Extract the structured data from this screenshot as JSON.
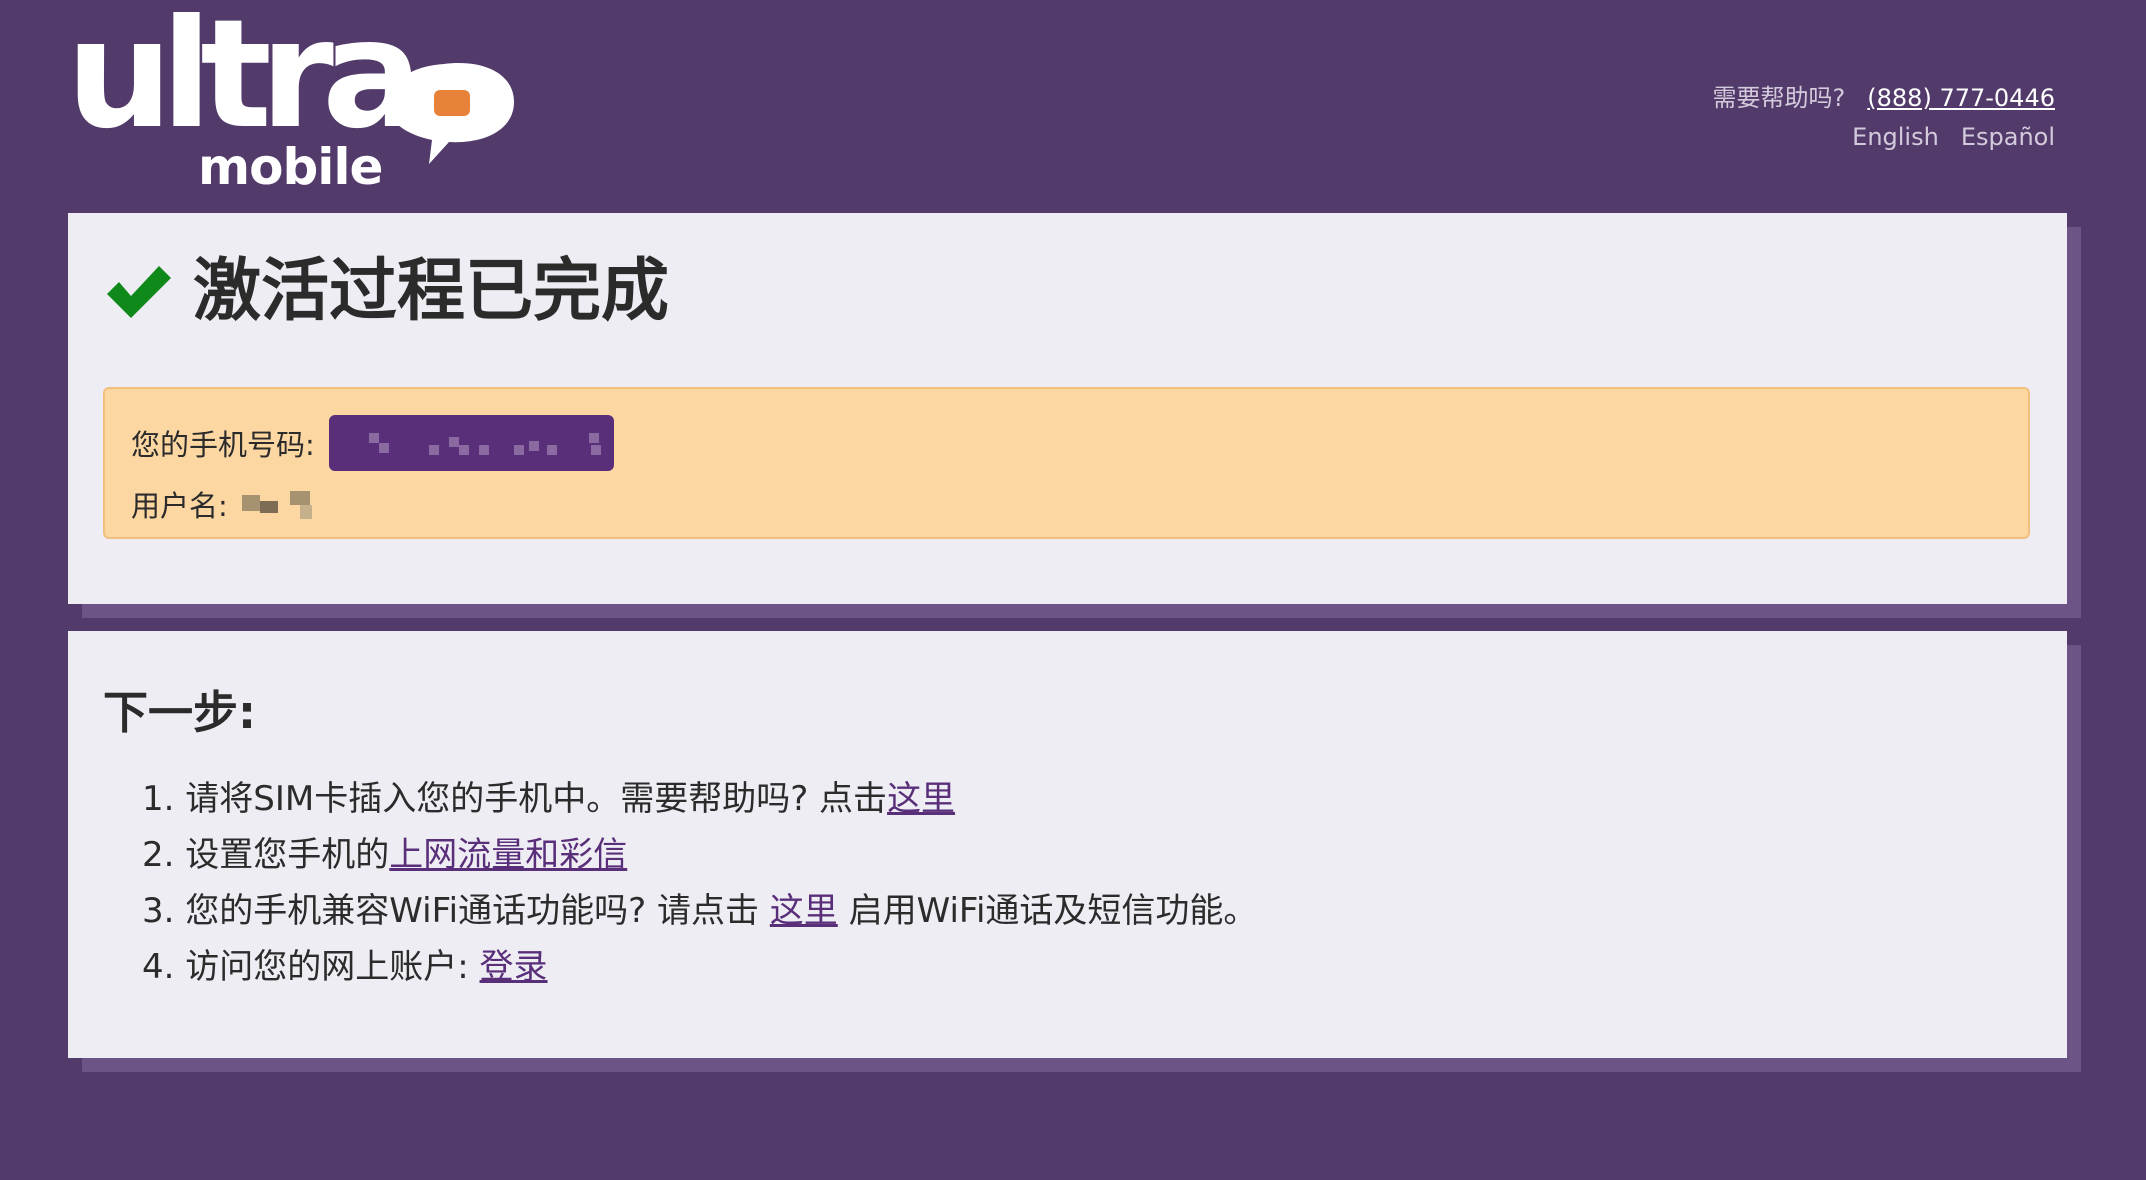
{
  "header": {
    "logo_word": "ultra",
    "logo_sub": "mobile",
    "help_text": "需要帮助吗?",
    "phone": "(888) 777-0446",
    "languages": [
      "English",
      "Español"
    ]
  },
  "card1": {
    "title": "激活过程已完成",
    "phone_label": "您的手机号码:",
    "username_label": "用户名:"
  },
  "card2": {
    "heading": "下一步:",
    "steps": [
      {
        "num": "1.",
        "text": "请将SIM卡插入您的手机中。需要帮助吗? 点击",
        "link": "这里",
        "after": ""
      },
      {
        "num": "2.",
        "text": "设置您手机的",
        "link": "上网流量和彩信",
        "after": ""
      },
      {
        "num": "3.",
        "text": "您的手机兼容WiFi通话功能吗? 请点击 ",
        "link": "这里",
        "after": " 启用WiFi通话及短信功能。"
      },
      {
        "num": "4.",
        "text": "访问您的网上账户: ",
        "link": "登录",
        "after": ""
      }
    ]
  },
  "colors": {
    "background": "#523b6b",
    "card": "#efedf4",
    "info_box": "#fdd7a2",
    "link": "#5a2f7a",
    "check": "#0f8a1a",
    "logo_bubble": "#e8823a"
  }
}
